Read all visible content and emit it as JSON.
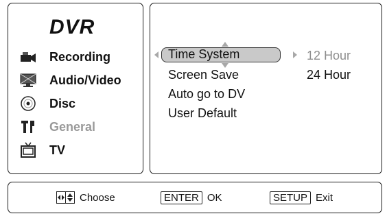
{
  "app": {
    "title": "DVR"
  },
  "sidebar": {
    "items": [
      {
        "label": "Recording",
        "icon": "camcorder-icon",
        "enabled": true
      },
      {
        "label": "Audio/Video",
        "icon": "monitor-icon",
        "enabled": true
      },
      {
        "label": "Disc",
        "icon": "disc-icon",
        "enabled": true
      },
      {
        "label": "General",
        "icon": "tools-icon",
        "enabled": false
      },
      {
        "label": "TV",
        "icon": "tv-icon",
        "enabled": true
      }
    ]
  },
  "menu": {
    "items": [
      "Time System",
      "Screen Save",
      "Auto go to DV",
      "User Default"
    ],
    "selected": "Time System",
    "options": [
      {
        "label": "12 Hour",
        "highlighted": false
      },
      {
        "label": "24 Hour",
        "highlighted": true
      }
    ]
  },
  "footer": {
    "choose_label": "Choose",
    "enter_key": "ENTER",
    "enter_label": "OK",
    "setup_key": "SETUP",
    "setup_label": "Exit"
  },
  "colors": {
    "selected_bg": "#c9c9c9",
    "disabled_text": "#9a9a9a",
    "arrow": "#a8a8a8"
  }
}
